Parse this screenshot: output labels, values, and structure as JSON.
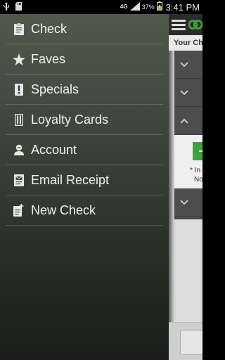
{
  "status_bar": {
    "network": "4G",
    "battery": "37%",
    "time": "3:41 PM"
  },
  "drawer": {
    "items": [
      {
        "label": "Check",
        "icon": "receipt-icon"
      },
      {
        "label": "Faves",
        "icon": "star-icon"
      },
      {
        "label": "Specials",
        "icon": "exclamation-icon"
      },
      {
        "label": "Loyalty Cards",
        "icon": "cards-icon"
      },
      {
        "label": "Account",
        "icon": "person-icon"
      },
      {
        "label": "Email Receipt",
        "icon": "email-receipt-icon"
      },
      {
        "label": "New Check",
        "icon": "new-check-icon"
      }
    ]
  },
  "content": {
    "section_header": "Your Ch",
    "note_line1": "* In",
    "note_line2": "No"
  },
  "colors": {
    "accent_green": "#3ea33a",
    "drawer_top": "#4f5a4c",
    "drawer_bottom": "#1b1f1b"
  }
}
